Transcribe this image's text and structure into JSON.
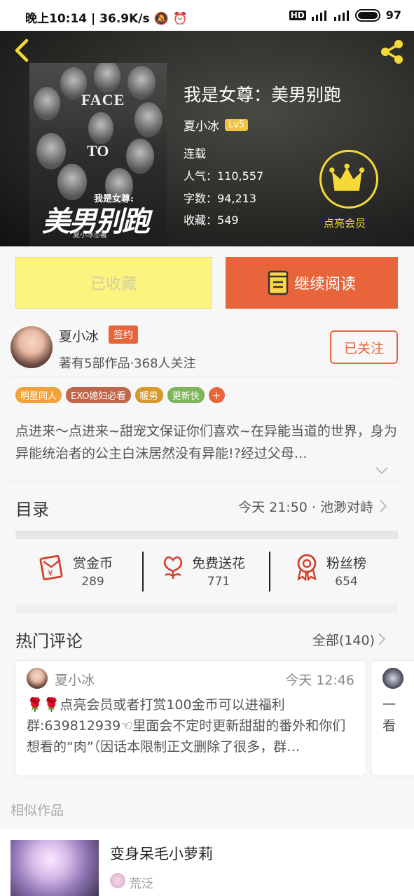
{
  "status_bar": {
    "time": "晚上10:14",
    "speed": "36.9K/s",
    "battery": "97"
  },
  "book": {
    "title": "我是女尊：美男别跑",
    "author": "夏小冰",
    "level": "Lv5",
    "status": "连载",
    "popularity_label": "人气：",
    "popularity": "110,557",
    "words_label": "字数：",
    "words": "94,213",
    "favorites_label": "收藏：",
    "favorites": "549",
    "cover_face": "FACE",
    "cover_to": "TO",
    "cover_subtitle": "我是女尊:",
    "cover_title": "美男别跑",
    "cover_author": "夏小冰◎著"
  },
  "vip": {
    "label": "点亮会员"
  },
  "actions": {
    "collected_label": "已收藏",
    "continue_label": "继续阅读"
  },
  "author_card": {
    "name": "夏小冰",
    "badge": "签约",
    "stats": "著有5部作品·368人关注",
    "follow_label": "已关注"
  },
  "tags": [
    {
      "label": "明星同人",
      "color": "#f0a33a"
    },
    {
      "label": "EXO媳妇必看",
      "color": "#c0664a"
    },
    {
      "label": "暖男",
      "color": "#d59a2e"
    },
    {
      "label": "更新快",
      "color": "#7cb55a"
    }
  ],
  "tag_more": "+",
  "description": "点进来～点进来~甜宠文保证你们喜欢~在异能当道的世界，身为异能统治者的公主白沫居然没有异能!?经过父母…",
  "toc": {
    "label": "目录",
    "latest": "今天 21:50 · 池渺对峙"
  },
  "stats": [
    {
      "label": "赏金币",
      "value": "289",
      "icon": "red-envelope-icon"
    },
    {
      "label": "免费送花",
      "value": "771",
      "icon": "flower-icon"
    },
    {
      "label": "粉丝榜",
      "value": "654",
      "icon": "medal-icon"
    }
  ],
  "comments": {
    "label": "热门评论",
    "all_label": "全部(140)",
    "items": [
      {
        "user": "夏小冰",
        "time": "今天 12:46",
        "body": "🌹🌹点亮会员或者打赏100金币可以进福利群:639812939☜里面会不定时更新甜甜的番外和你们想看的“肉”（因话本限制正文删除了很多，群…"
      }
    ],
    "peek_text_1": "一",
    "peek_text_2": "看"
  },
  "similar": {
    "label": "相似作品",
    "items": [
      {
        "title": "变身呆毛小萝莉",
        "author": "荒泛"
      }
    ]
  },
  "colors": {
    "accent": "#e8643a",
    "gold": "#f5d936",
    "collected_bg": "#fbf47e"
  }
}
